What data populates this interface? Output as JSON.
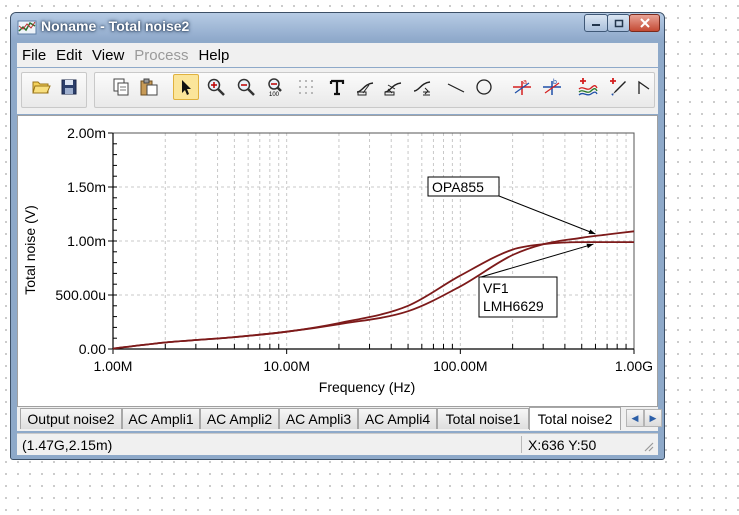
{
  "window": {
    "title": "Noname - Total noise2"
  },
  "menu": [
    {
      "label": "File",
      "disabled": false
    },
    {
      "label": "Edit",
      "disabled": false
    },
    {
      "label": "View",
      "disabled": false
    },
    {
      "label": "Process",
      "disabled": true
    },
    {
      "label": "Help",
      "disabled": false
    }
  ],
  "toolbar": {
    "groups": [
      [
        {
          "icon": "open-folder-icon"
        },
        {
          "icon": "save-disk-icon"
        }
      ],
      [
        {
          "icon": "copy-icon"
        },
        {
          "icon": "paste-icon"
        },
        {
          "icon": "select-arrow-icon",
          "active": true
        },
        {
          "icon": "zoom-in-icon"
        },
        {
          "icon": "zoom-out-icon"
        },
        {
          "icon": "zoom-100-icon"
        },
        {
          "icon": "grid-icon",
          "disabled": true
        },
        {
          "icon": "text-tool-icon"
        },
        {
          "icon": "curve-label-icon"
        },
        {
          "icon": "curve-tag-icon"
        },
        {
          "icon": "curve-edit-icon"
        },
        {
          "icon": "line-tool-icon"
        },
        {
          "icon": "circle-tool-icon"
        },
        {
          "icon": "cursor-a-icon"
        },
        {
          "icon": "cursor-b-icon"
        },
        {
          "icon": "add-curve-icon"
        },
        {
          "icon": "marker-pen-icon"
        },
        {
          "icon": "corner-tool-icon"
        }
      ]
    ]
  },
  "chart_data": {
    "type": "line",
    "xlabel": "Frequency (Hz)",
    "ylabel": "Total noise (V)",
    "x_scale": "log",
    "xlim": [
      1000000,
      1000000000
    ],
    "ylim": [
      0,
      0.002
    ],
    "x_ticks": [
      {
        "value": 1000000,
        "label": "1.00M"
      },
      {
        "value": 10000000,
        "label": "10.00M"
      },
      {
        "value": 100000000,
        "label": "100.00M"
      },
      {
        "value": 1000000000,
        "label": "1.00G"
      }
    ],
    "y_ticks": [
      {
        "value": 0,
        "label": "0.00"
      },
      {
        "value": 0.0005,
        "label": "500.00u"
      },
      {
        "value": 0.001,
        "label": "1.00m"
      },
      {
        "value": 0.0015,
        "label": "1.50m"
      },
      {
        "value": 0.002,
        "label": "2.00m"
      }
    ],
    "grid": true,
    "series": [
      {
        "name": "OPA855",
        "x": [
          1000000,
          2000000,
          5000000,
          10000000,
          20000000,
          50000000,
          100000000,
          200000000,
          300000000,
          500000000,
          700000000,
          1000000000
        ],
        "y": [
          5e-06,
          6e-05,
          0.00011,
          0.00016,
          0.00023,
          0.00035,
          0.00058,
          0.00087,
          0.00097,
          0.00103,
          0.00106,
          0.00109
        ]
      },
      {
        "name": "LMH6629",
        "x": [
          1000000,
          2000000,
          5000000,
          10000000,
          20000000,
          50000000,
          100000000,
          200000000,
          300000000,
          500000000,
          700000000,
          1000000000
        ],
        "y": [
          5e-06,
          6e-05,
          0.00011,
          0.00016,
          0.00024,
          0.0004,
          0.00068,
          0.00092,
          0.00097,
          0.00099,
          0.00099,
          0.00099
        ]
      }
    ],
    "annotations": [
      {
        "text": "OPA855",
        "points_to": "OPA855"
      },
      {
        "lines": [
          "VF1",
          "LMH6629"
        ],
        "points_to": "LMH6629"
      }
    ],
    "line_color": "#7d1a1a",
    "grid_color": "#c8c8c8"
  },
  "tabs": {
    "items": [
      "Output noise2",
      "AC Ampli1",
      "AC Ampli2",
      "AC Ampli3",
      "AC Ampli4",
      "Total noise1",
      "Total noise2"
    ],
    "active_index": 6
  },
  "status": {
    "coords": "(1.47G,2.15m)",
    "cursor": "X:636  Y:50"
  }
}
